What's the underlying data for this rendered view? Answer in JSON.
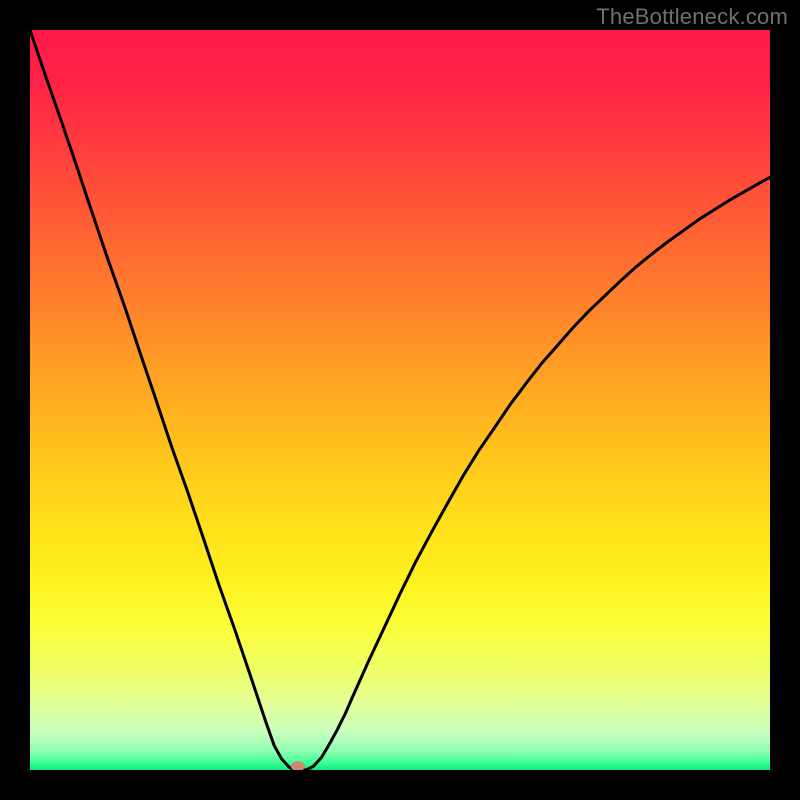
{
  "watermark": "TheBottleneck.com",
  "chart_data": {
    "type": "line",
    "title": "",
    "xlabel": "",
    "ylabel": "",
    "xlim": [
      0,
      100
    ],
    "ylim": [
      0,
      100
    ],
    "background_gradient": {
      "stops": [
        {
          "offset": 0.0,
          "color": "#ff1a49"
        },
        {
          "offset": 0.07,
          "color": "#ff2345"
        },
        {
          "offset": 0.15,
          "color": "#ff3a3f"
        },
        {
          "offset": 0.25,
          "color": "#ff5a35"
        },
        {
          "offset": 0.35,
          "color": "#ff7b2d"
        },
        {
          "offset": 0.45,
          "color": "#ff9c25"
        },
        {
          "offset": 0.55,
          "color": "#ffbd1e"
        },
        {
          "offset": 0.65,
          "color": "#ffdb1a"
        },
        {
          "offset": 0.74,
          "color": "#fff01f"
        },
        {
          "offset": 0.8,
          "color": "#fbff34"
        },
        {
          "offset": 0.86,
          "color": "#f0ff62"
        },
        {
          "offset": 0.91,
          "color": "#e3ff97"
        },
        {
          "offset": 0.95,
          "color": "#c7ffbf"
        },
        {
          "offset": 0.975,
          "color": "#8dffb0"
        },
        {
          "offset": 0.99,
          "color": "#3dff95"
        },
        {
          "offset": 1.0,
          "color": "#10e884"
        }
      ]
    },
    "series": [
      {
        "name": "bottleneck-curve",
        "color": "#000000",
        "stroke_width": 3,
        "x": [
          0.0,
          2.1,
          4.3,
          6.4,
          8.5,
          10.6,
          12.8,
          14.9,
          17.0,
          19.1,
          21.3,
          23.4,
          25.5,
          27.7,
          29.8,
          31.9,
          33.0,
          34.0,
          35.0,
          35.8,
          36.5,
          37.3,
          38.3,
          39.4,
          40.4,
          41.5,
          42.6,
          43.6,
          45.7,
          47.9,
          50.0,
          52.1,
          54.3,
          56.4,
          58.5,
          60.6,
          62.8,
          64.9,
          67.0,
          69.1,
          71.3,
          73.4,
          75.5,
          77.7,
          79.8,
          81.9,
          84.0,
          86.2,
          88.3,
          90.4,
          92.6,
          94.7,
          96.8,
          98.9,
          100.0
        ],
        "y": [
          100.0,
          93.8,
          87.5,
          81.3,
          75.0,
          68.8,
          62.6,
          56.3,
          50.1,
          43.8,
          37.6,
          31.4,
          25.1,
          18.9,
          12.7,
          6.4,
          3.3,
          1.5,
          0.4,
          0.0,
          0.0,
          0.0,
          0.5,
          1.7,
          3.4,
          5.4,
          7.6,
          9.9,
          14.6,
          19.3,
          23.8,
          28.1,
          32.2,
          36.0,
          39.7,
          43.1,
          46.3,
          49.4,
          52.2,
          54.9,
          57.4,
          59.8,
          62.0,
          64.1,
          66.1,
          68.0,
          69.7,
          71.4,
          72.9,
          74.4,
          75.8,
          77.1,
          78.3,
          79.5,
          80.1
        ]
      }
    ],
    "marker": {
      "name": "optimal-point",
      "x": 36.2,
      "y": 0.5,
      "color": "#d4866f",
      "rx": 7,
      "ry": 5
    }
  }
}
